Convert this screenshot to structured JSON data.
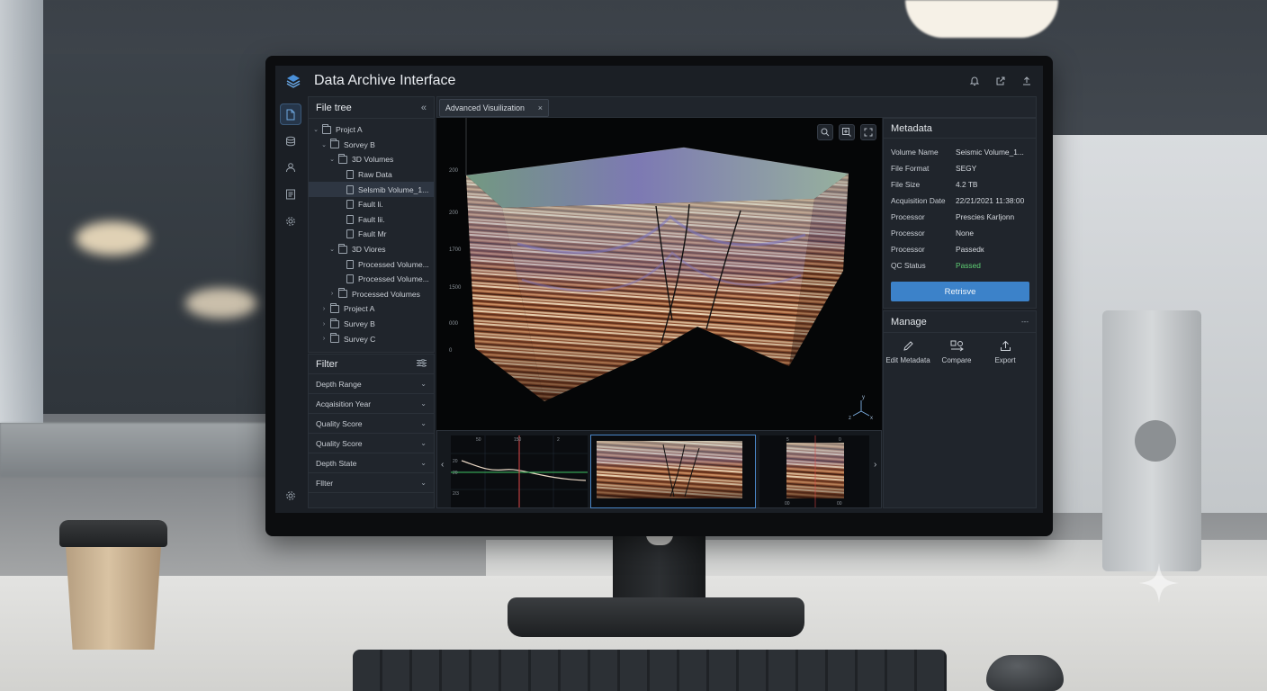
{
  "app": {
    "title": "Data Archive Interface"
  },
  "file_tree": {
    "title": "File tree",
    "items": [
      {
        "label": "Projct A",
        "depth": 0,
        "type": "folder",
        "expanded": true
      },
      {
        "label": "Sorvey B",
        "depth": 1,
        "type": "folder",
        "expanded": true
      },
      {
        "label": "3D Volumes",
        "depth": 2,
        "type": "folder",
        "expanded": true
      },
      {
        "label": "Raw Data",
        "depth": 3,
        "type": "file"
      },
      {
        "label": "Selsmib Volume_1...",
        "depth": 3,
        "type": "file",
        "selected": true
      },
      {
        "label": "Fault li.",
        "depth": 3,
        "type": "file"
      },
      {
        "label": "Fault lii.",
        "depth": 3,
        "type": "file"
      },
      {
        "label": "Fault Mr",
        "depth": 3,
        "type": "file"
      },
      {
        "label": "3D Viores",
        "depth": 2,
        "type": "folder",
        "expanded": true
      },
      {
        "label": "Processed Volume...",
        "depth": 3,
        "type": "file"
      },
      {
        "label": "Processed Volume...",
        "depth": 3,
        "type": "file"
      },
      {
        "label": "Processed Volumes",
        "depth": 2,
        "type": "folder",
        "expanded": false
      },
      {
        "label": "Project A",
        "depth": 1,
        "type": "folder",
        "expanded": false
      },
      {
        "label": "Survey B",
        "depth": 1,
        "type": "folder",
        "expanded": false
      },
      {
        "label": "Survey C",
        "depth": 1,
        "type": "folder",
        "expanded": false
      }
    ]
  },
  "filter": {
    "title": "Filter",
    "items": [
      "Depth Range",
      "Acqaisition Year",
      "Quality Score",
      "Quality Score",
      "Depth State",
      "Fllter"
    ]
  },
  "tabs": [
    {
      "label": "Advanced Visuilization"
    }
  ],
  "viewport": {
    "depth_labels": [
      "200",
      "200",
      "1700",
      "1500",
      "000",
      "0"
    ],
    "axis_labels": [
      "y",
      "z",
      "x"
    ],
    "thumbnail_labels": {
      "t1_top": [
        "50",
        "150",
        "2"
      ],
      "t1_left": [
        "20",
        "20",
        "2/3"
      ],
      "t3_top": [
        "5",
        "0"
      ],
      "t3_bottom": [
        "00",
        "00"
      ]
    }
  },
  "metadata": {
    "title": "Metadata",
    "rows": [
      {
        "key": "Volume Name",
        "value": "Seismic Volume_1..."
      },
      {
        "key": "File Format",
        "value": "SEGY"
      },
      {
        "key": "File Size",
        "value": "4.2 TB"
      },
      {
        "key": "Acquisition Date",
        "value": "22/21/2021 11:38:00"
      },
      {
        "key": "Processor",
        "value": "Prescies Ƙarljonn"
      },
      {
        "key": "Processor",
        "value": "None"
      },
      {
        "key": "Processor",
        "value": "Passedк"
      },
      {
        "key": "QC Status",
        "value": "Passed"
      }
    ],
    "retrieve_label": "Retrisve"
  },
  "manage": {
    "title": "Manage",
    "more": "---",
    "actions": [
      {
        "label": "Edit Metadata",
        "icon": "pencil-icon"
      },
      {
        "label": "Compare",
        "icon": "compare-icon"
      },
      {
        "label": "Export",
        "icon": "export-icon"
      }
    ]
  },
  "colors": {
    "accent": "#3c82c9",
    "passed": "#5fcf74",
    "panel": "#20252c",
    "screen": "#1b1f25"
  }
}
